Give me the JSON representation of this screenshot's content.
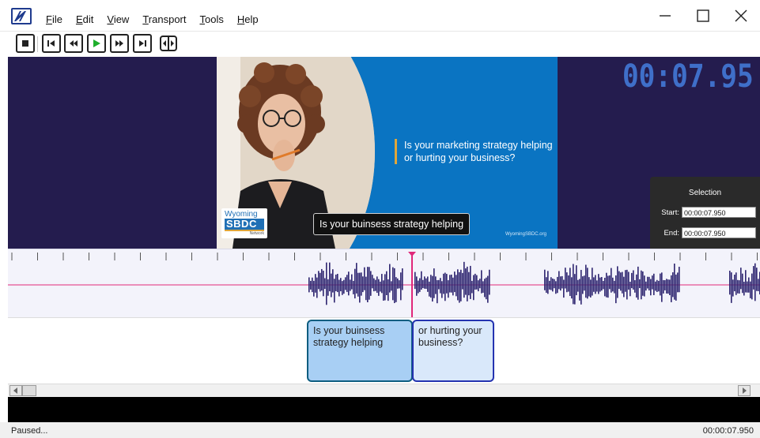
{
  "menu": {
    "items": [
      {
        "key": "F",
        "rest": "ile"
      },
      {
        "key": "E",
        "rest": "dit"
      },
      {
        "key": "V",
        "rest": "iew"
      },
      {
        "key": "T",
        "rest": "ransport"
      },
      {
        "key": "T",
        "rest": "ools"
      },
      {
        "key": "H",
        "rest": "elp"
      }
    ]
  },
  "icons": {
    "logo": "app-logo-icon",
    "minimize": "minimize-icon",
    "maximize": "maximize-icon",
    "close": "close-icon"
  },
  "toolbar": {
    "buttons": [
      "stop",
      "skip-to-start",
      "rewind",
      "play",
      "fast-forward",
      "skip-to-end",
      "split"
    ]
  },
  "video": {
    "headline": "Is your marketing strategy helping or hurting your business?",
    "logo_top": "Wyoming",
    "logo_main": "SBDC",
    "logo_sub": "Network",
    "site_url": "WyomingSBDC.org",
    "caption": "Is your buinsess strategy helping",
    "timer": "00:07.95"
  },
  "selection": {
    "title": "Selection",
    "start_label": "Start:",
    "start_value": "00:00:07.950",
    "end_label": "End:",
    "end_value": "00:00:07.950"
  },
  "captions": [
    {
      "text": "Is your buinsess strategy helping"
    },
    {
      "text": "or hurting your business?"
    }
  ],
  "status": {
    "state": "Paused...",
    "position": "00:00:07.950"
  },
  "colors": {
    "video_bg": "#241c4e",
    "frame_bg": "#0a74c2",
    "playhead": "#e0287a",
    "waveform": "#2e2570",
    "timer": "#3f6fc9",
    "accent_gold": "#e0a63a"
  }
}
